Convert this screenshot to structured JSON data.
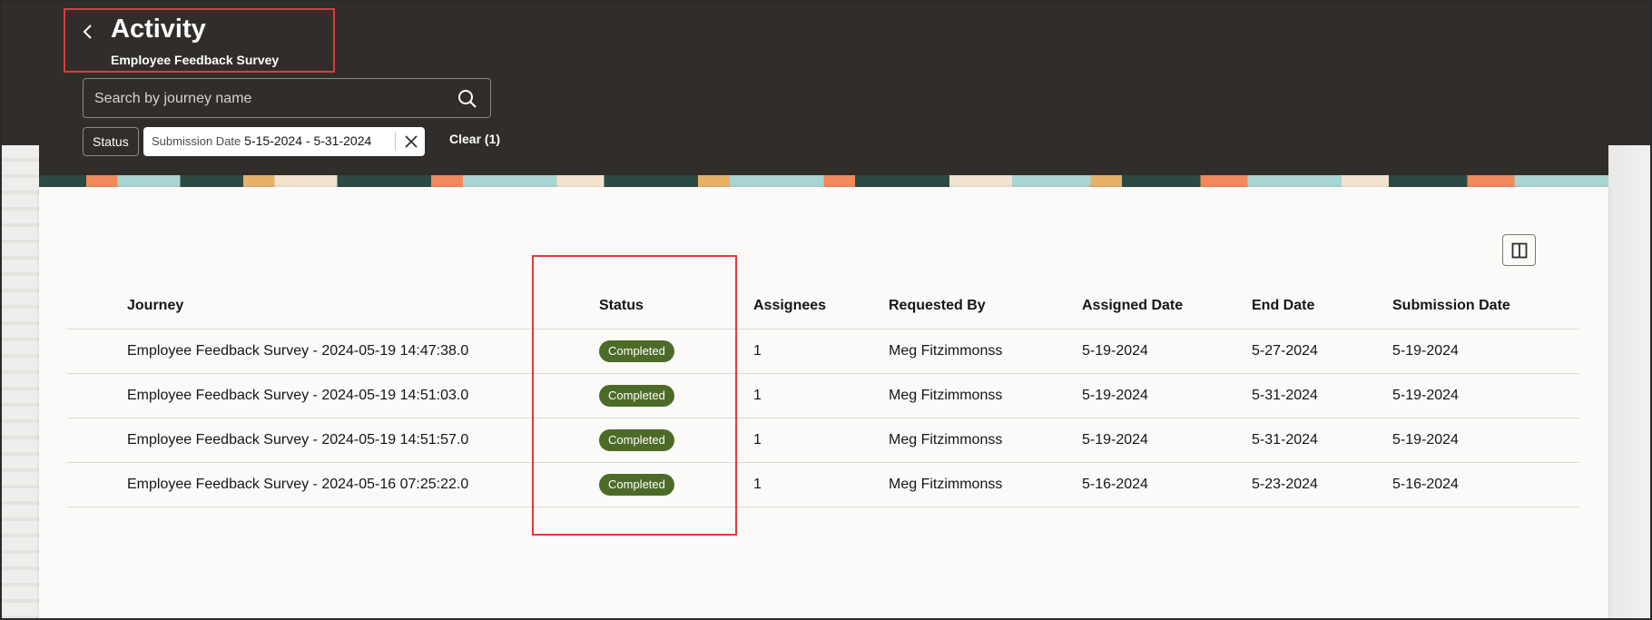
{
  "header": {
    "title": "Activity",
    "subtitle": "Employee Feedback Survey",
    "back_icon": "chevron-left-icon"
  },
  "search": {
    "placeholder": "Search by journey name",
    "value": "",
    "icon": "search-icon"
  },
  "filters": {
    "status_label": "Status",
    "date_label": "Submission Date",
    "date_value": "5-15-2024 - 5-31-2024",
    "clear_label": "Clear (1)"
  },
  "table": {
    "columns": [
      "Journey",
      "Status",
      "Assignees",
      "Requested By",
      "Assigned Date",
      "End Date",
      "Submission Date"
    ],
    "rows": [
      {
        "journey": "Employee Feedback Survey - 2024-05-19 14:47:38.0",
        "status": "Completed",
        "assignees": "1",
        "requested_by": "Meg Fitzimmonss",
        "assigned_date": "5-19-2024",
        "end_date": "5-27-2024",
        "submission_date": "5-19-2024"
      },
      {
        "journey": "Employee Feedback Survey - 2024-05-19 14:51:03.0",
        "status": "Completed",
        "assignees": "1",
        "requested_by": "Meg Fitzimmonss",
        "assigned_date": "5-19-2024",
        "end_date": "5-31-2024",
        "submission_date": "5-19-2024"
      },
      {
        "journey": "Employee Feedback Survey - 2024-05-19 14:51:57.0",
        "status": "Completed",
        "assignees": "1",
        "requested_by": "Meg Fitzimmonss",
        "assigned_date": "5-19-2024",
        "end_date": "5-31-2024",
        "submission_date": "5-19-2024"
      },
      {
        "journey": "Employee Feedback Survey - 2024-05-16 07:25:22.0",
        "status": "Completed",
        "assignees": "1",
        "requested_by": "Meg Fitzimmonss",
        "assigned_date": "5-16-2024",
        "end_date": "5-23-2024",
        "submission_date": "5-16-2024"
      }
    ]
  },
  "colors": {
    "header_bg": "#312d2a",
    "badge_bg": "#4d6b28",
    "highlight": "#e0393f"
  }
}
